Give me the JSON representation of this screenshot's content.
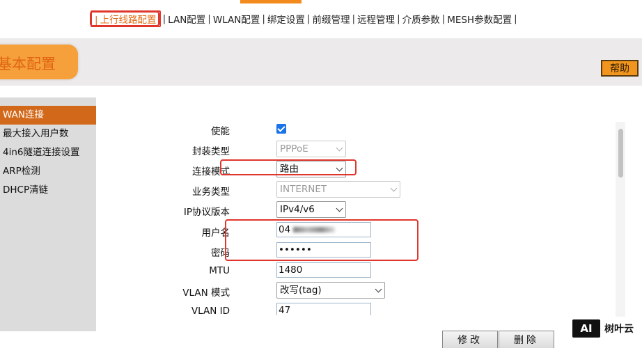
{
  "top_cut_text": "",
  "nav": {
    "items": [
      {
        "label": "上行线路配置",
        "active": true
      },
      {
        "label": "LAN配置"
      },
      {
        "label": "WLAN配置"
      },
      {
        "label": "绑定设置"
      },
      {
        "label": "前缀管理"
      },
      {
        "label": "远程管理"
      },
      {
        "label": "介质参数"
      },
      {
        "label": "MESH参数配置"
      }
    ]
  },
  "section_title": "基本配置",
  "help_label": "帮助",
  "sidebar": {
    "items": [
      {
        "label": "WAN连接",
        "active": true
      },
      {
        "label": "最大接入用户数"
      },
      {
        "label": "4in6隧道连接设置"
      },
      {
        "label": "ARP检测"
      },
      {
        "label": "DHCP清链"
      }
    ]
  },
  "form": {
    "enable_label": "使能",
    "enable_checked": true,
    "encap_label": "封装类型",
    "encap_value": "PPPoE",
    "conn_mode_label": "连接模式",
    "conn_mode_value": "路由",
    "service_label": "业务类型",
    "service_value": "INTERNET",
    "ip_version_label": "IP协议版本",
    "ip_version_value": "IPv4/v6",
    "username_label": "用户名",
    "username_value": "04",
    "password_label": "密码",
    "password_value": "••••••",
    "mtu_label": "MTU",
    "mtu_value": "1480",
    "vlan_mode_label": "VLAN 模式",
    "vlan_mode_value": "改写(tag)",
    "vlan_id_label": "VLAN ID",
    "vlan_id_value": "47"
  },
  "buttons": {
    "modify": "修改",
    "delete": "删除"
  },
  "watermark": {
    "logo": "AI",
    "text": "树叶云"
  },
  "colors": {
    "accent": "#e46a12",
    "highlight_red": "#e0352b",
    "sidebar_active": "#d2691a",
    "help_button": "#f1951e"
  }
}
